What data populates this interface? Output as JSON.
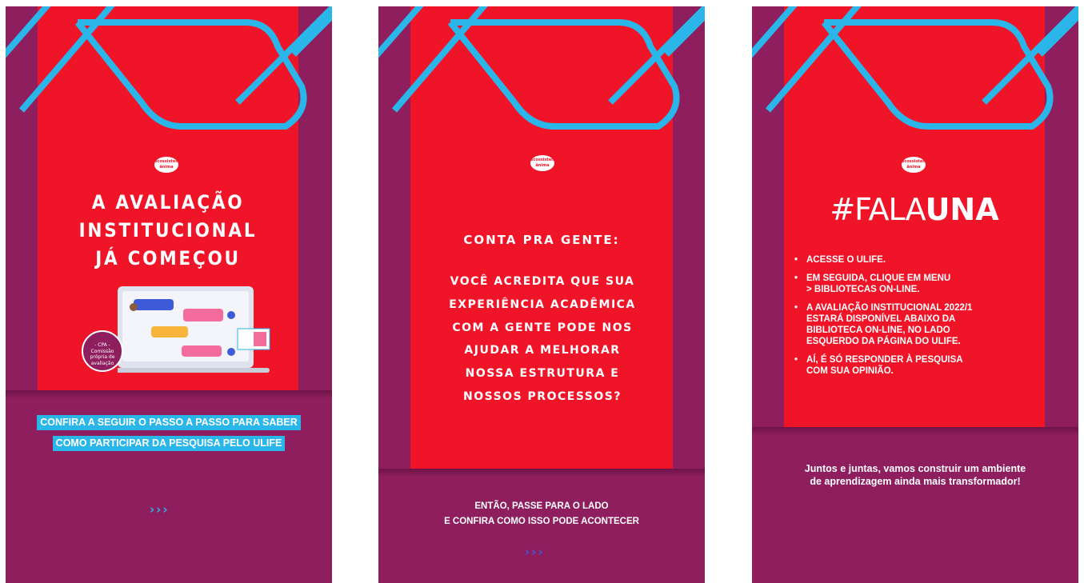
{
  "logo": {
    "line1": "ecossistema",
    "line2": "ânima"
  },
  "slide1": {
    "headline": [
      "A AVALIAÇÃO",
      "INSTITUCIONAL",
      "JÁ COMEÇOU"
    ],
    "badge": [
      "- CPA -",
      "Comissão",
      "própria de",
      "avaliação"
    ],
    "chips": [
      "CONFIRA A SEGUIR O PASSO A PASSO PARA SABER",
      "COMO PARTICIPAR DA PESQUISA PELO ULIFE"
    ],
    "arrows": "›››"
  },
  "slide2": {
    "title": "CONTA PRA GENTE:",
    "question": [
      "VOCÊ ACREDITA QUE SUA",
      "EXPERIÊNCIA ACADÊMICA",
      "COM A GENTE PODE NOS",
      "AJUDAR A MELHORAR",
      "NOSSA ESTRUTURA E",
      "NOSSOS PROCESSOS?"
    ],
    "bottom": [
      "ENTÃO, PASSE PARA O LADO",
      "E CONFIRA COMO ISSO PODE ACONTECER"
    ],
    "arrows": "›››"
  },
  "slide3": {
    "hashtag_a": "#FALA",
    "hashtag_b": "UNA",
    "steps": [
      [
        "ACESSE O ULIFE."
      ],
      [
        "EM SEGUIDA, CLIQUE EM MENU",
        "> BIBLIOTECAS ON-LINE."
      ],
      [
        "A AVALIAÇÃO INSTITUCIONAL 2022/1",
        "ESTARÁ DISPONÍVEL ABAIXO DA",
        "BIBLIOTECA ON-LINE, NO LADO",
        "ESQUERDO DA PÁGINA DO ULIFE."
      ],
      [
        "AÍ, É SÓ RESPONDER À PESQUISA",
        "COM SUA OPINIÃO."
      ]
    ],
    "closing": [
      "Juntos e juntas, vamos construir um ambiente",
      "de aprendizagem ainda mais transformador!"
    ]
  },
  "colors": {
    "red": "#f01428",
    "purple": "#8e1e5e",
    "cyan": "#2ab6e8"
  }
}
